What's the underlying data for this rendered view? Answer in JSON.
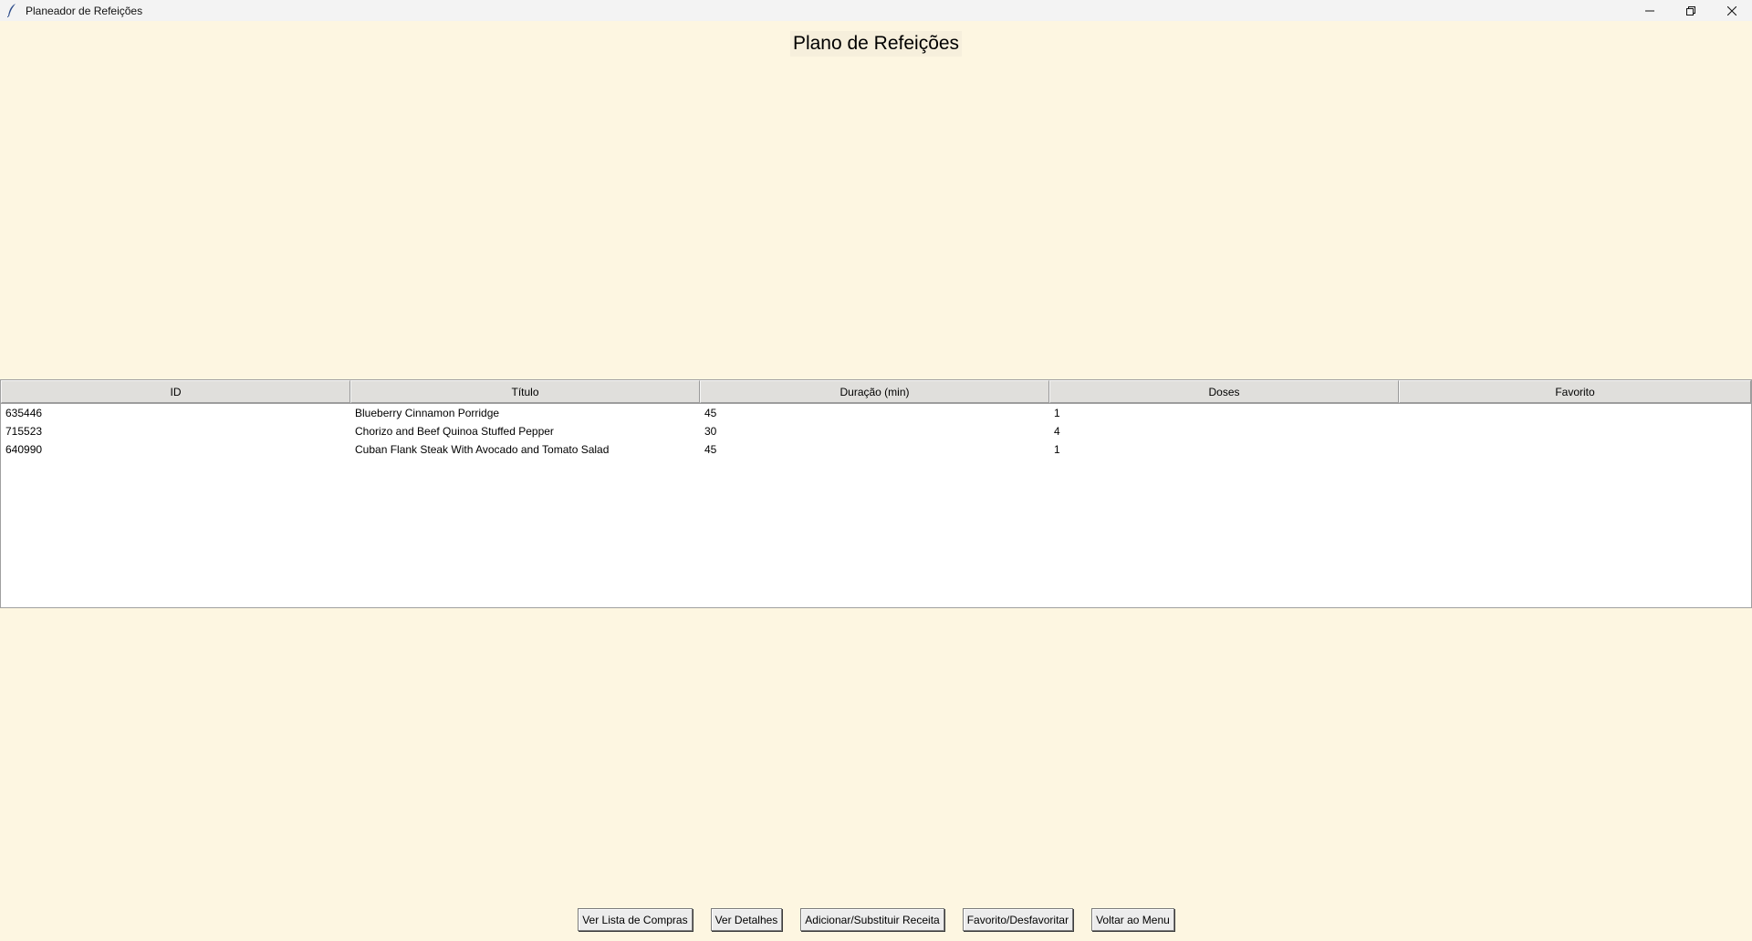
{
  "window": {
    "title": "Planeador de Refeições",
    "icons": [
      "feather-icon",
      "minimize-icon",
      "restore-icon",
      "close-icon"
    ]
  },
  "page": {
    "title": "Plano de Refeições"
  },
  "table": {
    "columns": [
      "ID",
      "Título",
      "Duração (min)",
      "Doses",
      "Favorito"
    ],
    "rows": [
      {
        "id": "635446",
        "titulo": "Blueberry Cinnamon Porridge",
        "duracao": "45",
        "doses": "1",
        "favorito": ""
      },
      {
        "id": "715523",
        "titulo": "Chorizo and Beef Quinoa Stuffed Pepper",
        "duracao": "30",
        "doses": "4",
        "favorito": ""
      },
      {
        "id": "640990",
        "titulo": "Cuban Flank Steak With Avocado and Tomato Salad",
        "duracao": "45",
        "doses": "1",
        "favorito": ""
      }
    ]
  },
  "buttons": {
    "shopping_list": "Ver Lista de Compras",
    "details": "Ver Detalhes",
    "add_replace": "Adicionar/Substituir Receita",
    "favorite": "Favorito/Desfavoritar",
    "back": "Voltar ao Menu"
  },
  "colors": {
    "background": "#FDF6E1",
    "titlebar": "#f3f3f3",
    "table_header": "#e0dfdc",
    "table_body": "#ffffff",
    "button": "#ececec"
  }
}
